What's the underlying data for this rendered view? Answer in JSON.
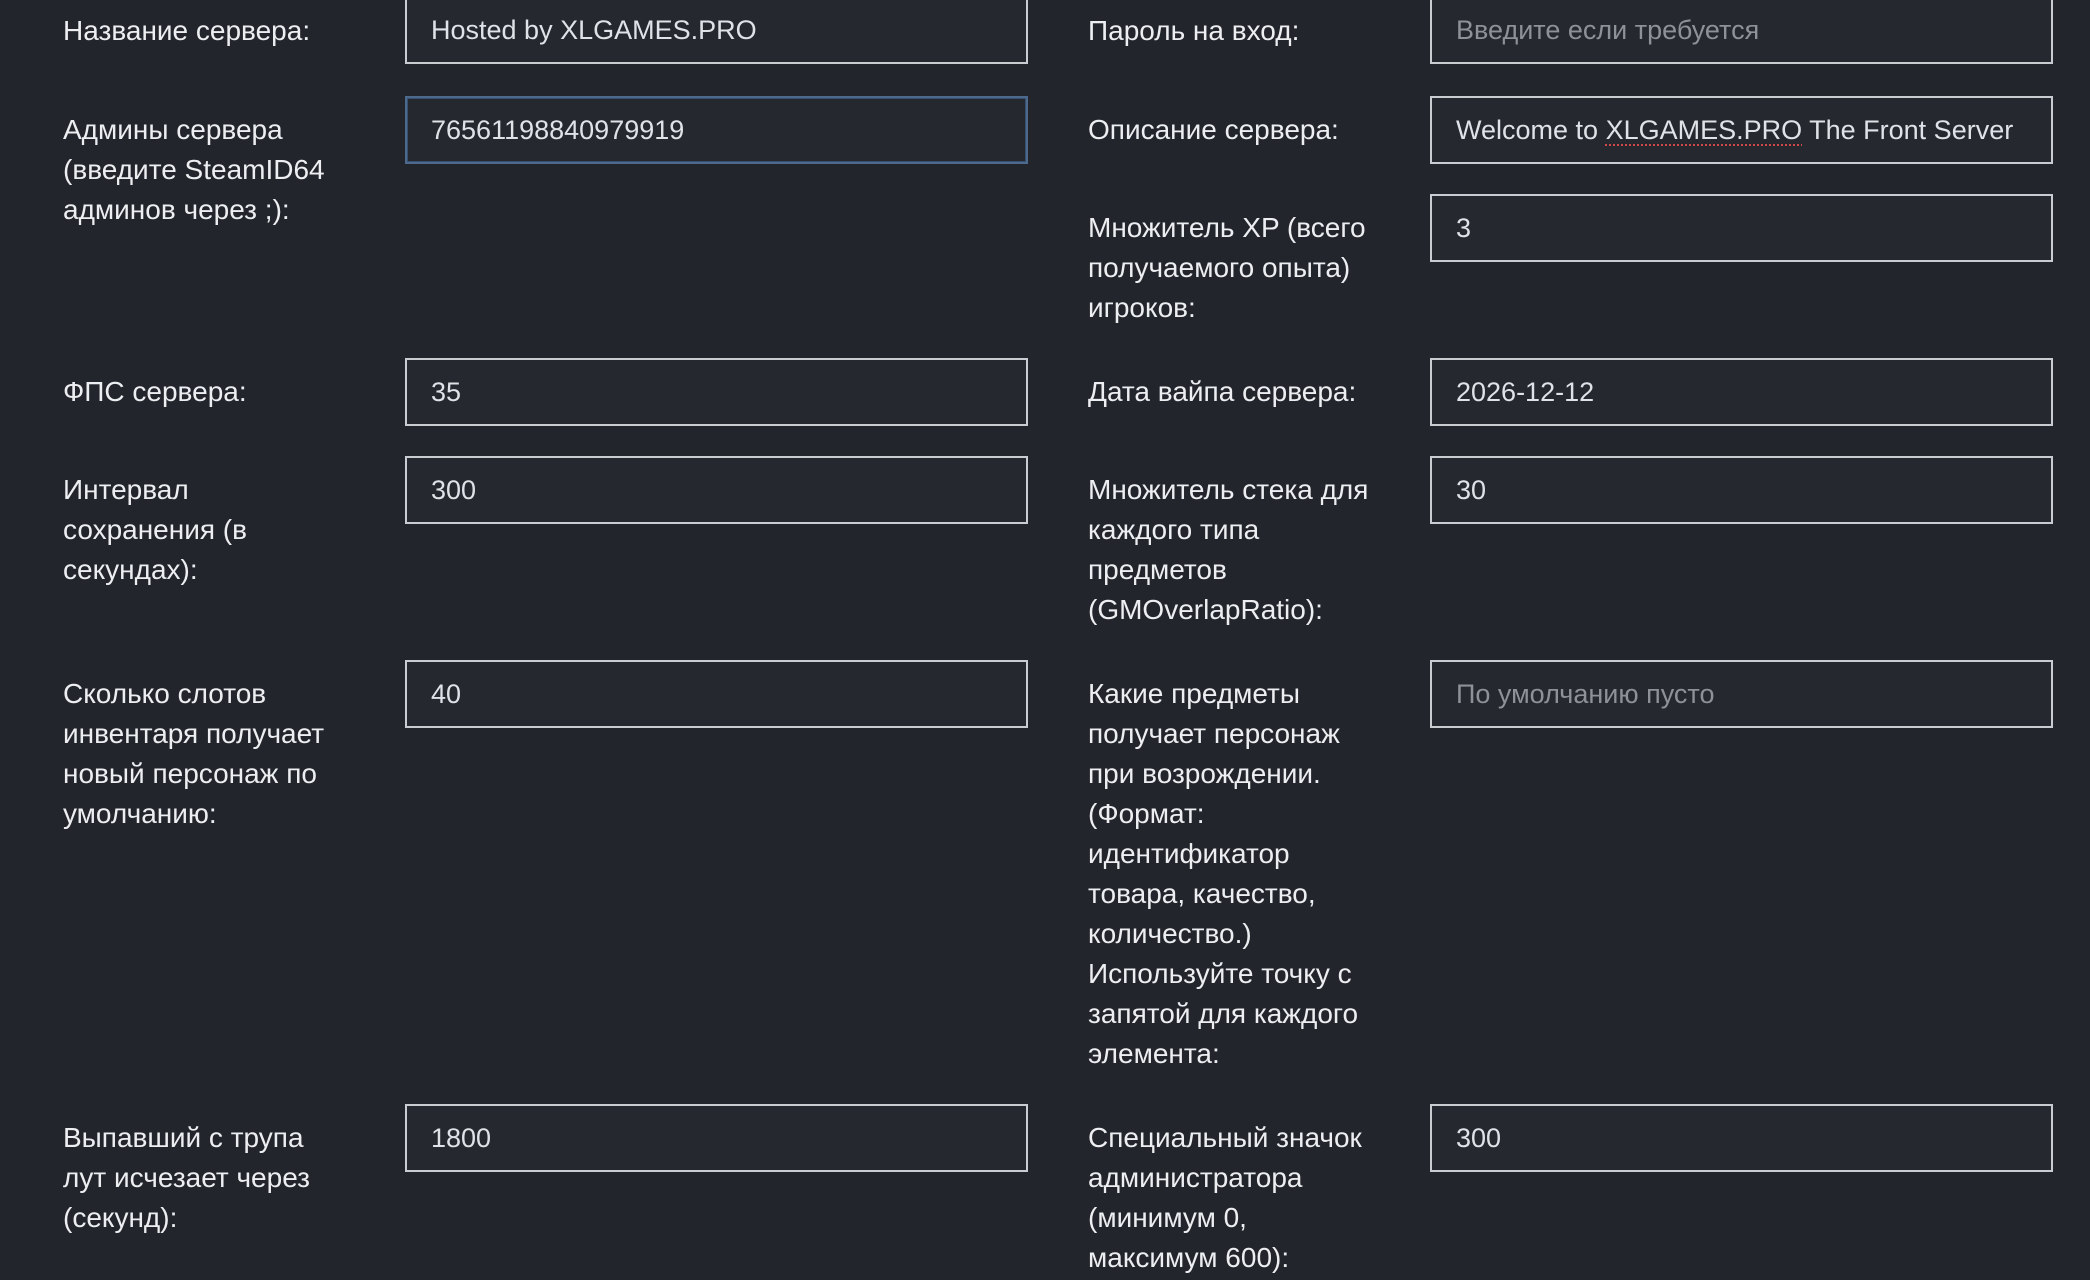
{
  "left": {
    "server_name": {
      "label": "Название сервера:",
      "value": "Hosted by XLGAMES.PRO"
    },
    "admins": {
      "label": "Админы сервера\n(введите SteamID64\nадминов через ;):",
      "value": "76561198840979919"
    },
    "fps": {
      "label": "ФПС сервера:",
      "value": "35"
    },
    "save_interval": {
      "label": "Интервал\nсохранения (в\nсекундах):",
      "value": "300"
    },
    "inventory_slots": {
      "label": "Сколько слотов\nинвентаря получает\nновый персонаж по\nумолчанию:",
      "value": "40"
    },
    "corpse_loot": {
      "label": "Выпавший с трупа\nлут исчезает через\n(секунд):",
      "value": "1800"
    }
  },
  "right": {
    "password": {
      "label": "Пароль на вход:",
      "value": "",
      "placeholder": "Введите если требуется"
    },
    "description": {
      "label": "Описание сервера:",
      "prefix": "Welcome to ",
      "highlight": "XLGAMES.PRO",
      "suffix": " The Front Server"
    },
    "xp_multiplier": {
      "label": "Множитель XP (всего\nполучаемого опыта)\nигроков:",
      "value": "3"
    },
    "wipe_date": {
      "label": "Дата вайпа сервера:",
      "value": "2026-12-12"
    },
    "stack_multiplier": {
      "label": "Множитель стека для\nкаждого типа\nпредметов\n(GMOverlapRatio):",
      "value": "30"
    },
    "respawn_items": {
      "label": "Какие предметы\nполучает персонаж\nпри возрождении.\n(Формат:\nидентификатор\nтовара, качество,\nколичество.)\nИспользуйте точку с\nзапятой для каждого\nэлемента:",
      "value": "",
      "placeholder": "По умолчанию пусто"
    },
    "admin_badge": {
      "label": "Специальный значок\nадминистратора\n(минимум 0,\nмаксимум 600):",
      "value": "300"
    }
  }
}
